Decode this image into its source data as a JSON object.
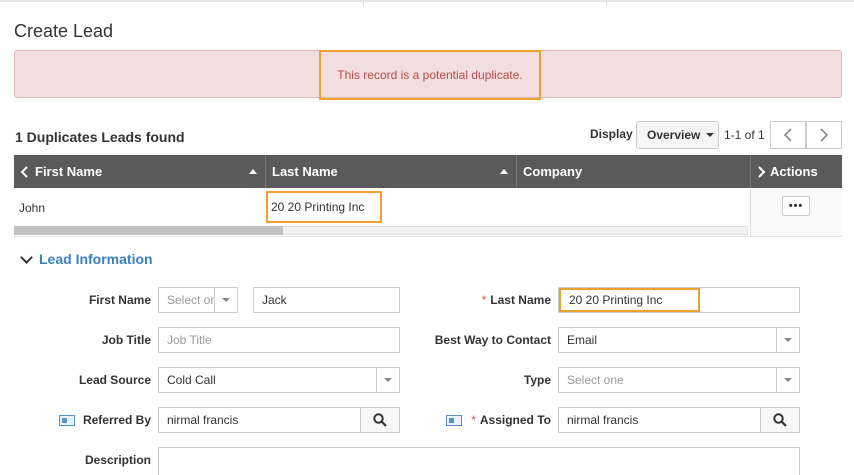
{
  "page": {
    "title": "Create Lead"
  },
  "alert": {
    "message": "This record is a potential duplicate."
  },
  "duplicates": {
    "count_label": "1 Duplicates Leads found",
    "display_label": "Display",
    "view_selected": "Overview",
    "pager_text": "1-1 of 1",
    "columns": [
      "First Name",
      "Last Name",
      "Company",
      "Actions"
    ],
    "rows": [
      {
        "first_name": "John",
        "last_name": "20 20 Printing Inc",
        "company": "",
        "actions": "•••"
      }
    ]
  },
  "lead_info": {
    "section_title": "Lead Information",
    "fields": {
      "first_name": {
        "label": "First Name",
        "salutation_placeholder": "Select one",
        "value": "Jack"
      },
      "last_name": {
        "label": "Last Name",
        "value": "20 20 Printing Inc",
        "required": "*"
      },
      "job_title": {
        "label": "Job Title",
        "placeholder": "Job Title"
      },
      "best_way": {
        "label": "Best Way to Contact",
        "value": "Email"
      },
      "lead_source": {
        "label": "Lead Source",
        "value": "Cold Call"
      },
      "type": {
        "label": "Type",
        "placeholder": "Select one"
      },
      "referred_by": {
        "label": "Referred By",
        "value": "nirmal francis"
      },
      "assigned_to": {
        "label": "Assigned To",
        "value": "nirmal francis",
        "required": "*"
      },
      "description": {
        "label": "Description",
        "value": ""
      }
    }
  },
  "icons": {
    "sort": "sort-up-icon",
    "search": "search-icon",
    "contact_card": "contact-card-icon"
  },
  "colors": {
    "highlight": "#f0a030",
    "alert_bg": "#f2dede",
    "alert_text": "#b94a48",
    "section_title": "#3a7fc1",
    "table_header": "#5a5a5a"
  }
}
